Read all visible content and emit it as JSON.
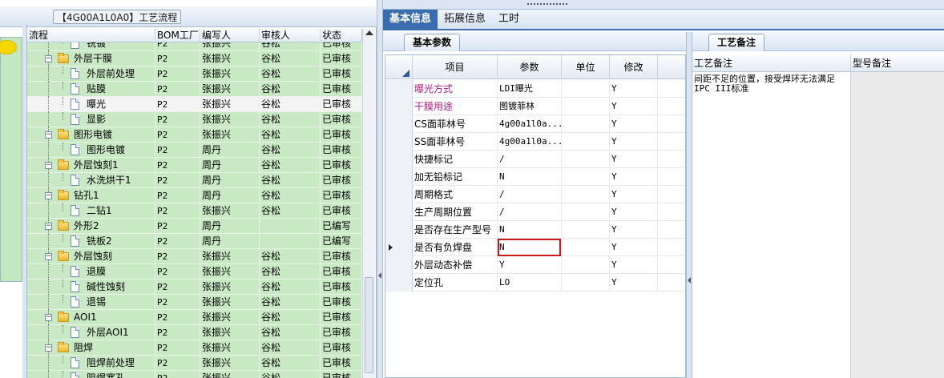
{
  "process_panel": {
    "title": "【4G00A1L0A0】工艺流程",
    "columns": [
      "流程",
      "BOM工厂",
      "编写人",
      "审核人",
      "状态"
    ],
    "rows": [
      {
        "name": "铣镀",
        "level": 2,
        "type": "doc",
        "bom": "P2",
        "author": "张振兴",
        "reviewer": "谷松",
        "status": "已审核"
      },
      {
        "name": "外层干膜",
        "level": 1,
        "type": "folder",
        "bom": "P2",
        "author": "张振兴",
        "reviewer": "谷松",
        "status": "已审核"
      },
      {
        "name": "外层前处理",
        "level": 2,
        "type": "doc",
        "bom": "P2",
        "author": "张振兴",
        "reviewer": "谷松",
        "status": "已审核"
      },
      {
        "name": "贴膜",
        "level": 2,
        "type": "doc",
        "bom": "P2",
        "author": "张振兴",
        "reviewer": "谷松",
        "status": "已审核"
      },
      {
        "name": "曝光",
        "level": 2,
        "type": "doc",
        "bom": "P2",
        "author": "张振兴",
        "reviewer": "谷松",
        "status": "已审核",
        "selected": true
      },
      {
        "name": "显影",
        "level": 2,
        "type": "doc",
        "bom": "P2",
        "author": "张振兴",
        "reviewer": "谷松",
        "status": "已审核"
      },
      {
        "name": "图形电镀",
        "level": 1,
        "type": "folder",
        "bom": "P2",
        "author": "张振兴",
        "reviewer": "谷松",
        "status": "已审核"
      },
      {
        "name": "图形电镀",
        "level": 2,
        "type": "doc",
        "bom": "P2",
        "author": "周丹",
        "reviewer": "谷松",
        "status": "已审核"
      },
      {
        "name": "外层蚀刻1",
        "level": 1,
        "type": "folder",
        "bom": "P2",
        "author": "周丹",
        "reviewer": "谷松",
        "status": "已审核"
      },
      {
        "name": "水洗烘干1",
        "level": 2,
        "type": "doc",
        "bom": "P2",
        "author": "周丹",
        "reviewer": "谷松",
        "status": "已审核"
      },
      {
        "name": "钻孔1",
        "level": 1,
        "type": "folder",
        "bom": "P2",
        "author": "周丹",
        "reviewer": "谷松",
        "status": "已审核"
      },
      {
        "name": "二钻1",
        "level": 2,
        "type": "doc",
        "bom": "P2",
        "author": "张振兴",
        "reviewer": "谷松",
        "status": "已审核"
      },
      {
        "name": "外形2",
        "level": 1,
        "type": "folder",
        "bom": "P2",
        "author": "周丹",
        "reviewer": "",
        "status": "已编写"
      },
      {
        "name": "铣板2",
        "level": 2,
        "type": "doc",
        "bom": "P2",
        "author": "周丹",
        "reviewer": "",
        "status": "已编写"
      },
      {
        "name": "外层蚀刻",
        "level": 1,
        "type": "folder",
        "bom": "P2",
        "author": "张振兴",
        "reviewer": "谷松",
        "status": "已审核"
      },
      {
        "name": "退膜",
        "level": 2,
        "type": "doc",
        "bom": "P2",
        "author": "张振兴",
        "reviewer": "谷松",
        "status": "已审核"
      },
      {
        "name": "碱性蚀刻",
        "level": 2,
        "type": "doc",
        "bom": "P2",
        "author": "张振兴",
        "reviewer": "谷松",
        "status": "已审核"
      },
      {
        "name": "退锡",
        "level": 2,
        "type": "doc",
        "bom": "P2",
        "author": "张振兴",
        "reviewer": "谷松",
        "status": "已审核"
      },
      {
        "name": "AOI1",
        "level": 1,
        "type": "folder",
        "bom": "P2",
        "author": "张振兴",
        "reviewer": "谷松",
        "status": "已审核"
      },
      {
        "name": "外层AOI1",
        "level": 2,
        "type": "doc",
        "bom": "P2",
        "author": "张振兴",
        "reviewer": "谷松",
        "status": "已审核"
      },
      {
        "name": "阻焊",
        "level": 1,
        "type": "folder",
        "bom": "P2",
        "author": "张振兴",
        "reviewer": "谷松",
        "status": "已审核"
      },
      {
        "name": "阻焊前处理",
        "level": 2,
        "type": "doc",
        "bom": "P2",
        "author": "张振兴",
        "reviewer": "谷松",
        "status": "已审核"
      },
      {
        "name": "阻焊塞孔",
        "level": 2,
        "type": "doc",
        "bom": "P2",
        "author": "张振兴",
        "reviewer": "谷松",
        "status": "已审核"
      }
    ]
  },
  "main_tabs": [
    {
      "label": "基本信息",
      "active": true
    },
    {
      "label": "拓展信息",
      "active": false
    },
    {
      "label": "工时",
      "active": false
    }
  ],
  "basic_params": {
    "tab_label": "基本参数",
    "columns": {
      "item": "项目",
      "value": "参数",
      "unit": "单位",
      "modify": "修改"
    },
    "rows": [
      {
        "item": "曝光方式",
        "value": "LDI曝光",
        "unit": "",
        "modify": "Y",
        "highlight": true
      },
      {
        "item": "干膜用途",
        "value": "图镀菲林",
        "unit": "",
        "modify": "Y",
        "highlight": true
      },
      {
        "item": "CS面菲林号",
        "value": "4g00a1l0a...",
        "unit": "",
        "modify": "Y"
      },
      {
        "item": "SS面菲林号",
        "value": "4g00a1l0a...",
        "unit": "",
        "modify": "Y"
      },
      {
        "item": "快捷标记",
        "value": "/",
        "unit": "",
        "modify": "Y"
      },
      {
        "item": "加无铅标记",
        "value": "N",
        "unit": "",
        "modify": "Y"
      },
      {
        "item": "周期格式",
        "value": "/",
        "unit": "",
        "modify": "Y"
      },
      {
        "item": "生产周期位置",
        "value": "/",
        "unit": "",
        "modify": "Y"
      },
      {
        "item": "是否存在生产型号",
        "value": "N",
        "unit": "",
        "modify": "Y"
      },
      {
        "item": "是否有负焊盘",
        "value": "N",
        "unit": "",
        "modify": "Y",
        "current": true,
        "editing": true
      },
      {
        "item": "外层动态补偿",
        "value": "Y",
        "unit": "",
        "modify": "Y"
      },
      {
        "item": "定位孔",
        "value": "LO",
        "unit": "",
        "modify": "Y"
      }
    ]
  },
  "process_notes": {
    "tab_label": "工艺备注",
    "columns": [
      "工艺备注",
      "型号备注"
    ],
    "note_text": "间距不足的位置，接受焊环无法满足IPC III标准"
  },
  "colors": {
    "tree_bg": "#c9e8c4",
    "active_tab": "#3a6db0",
    "highlight_text": "#b0208a",
    "edit_border": "#d01818"
  }
}
